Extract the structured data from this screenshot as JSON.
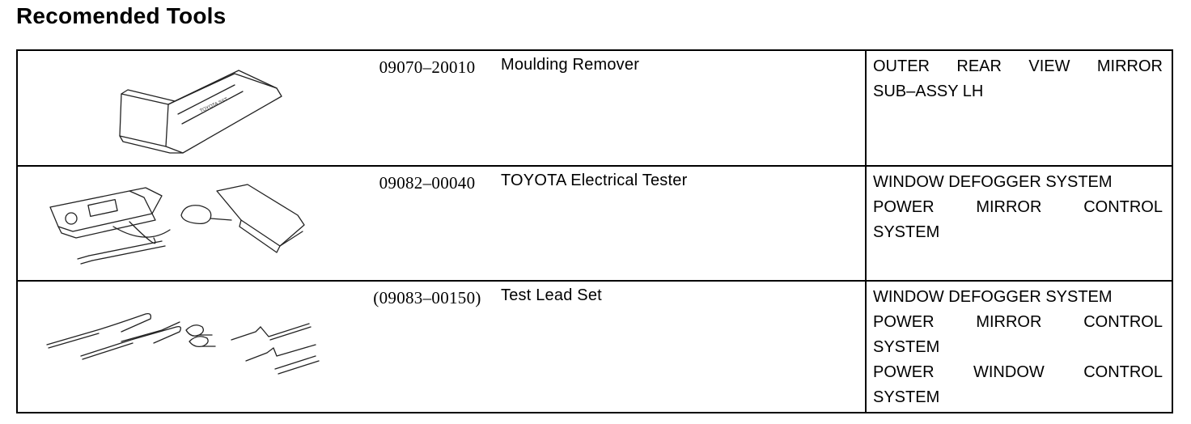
{
  "title": "Recomended Tools",
  "tools": [
    {
      "part_number": "09070–20010",
      "name": "Moulding Remover",
      "illustration_icon": "moulding-remover-illustration",
      "uses": [
        {
          "words": [
            "OUTER",
            "REAR",
            "VIEW",
            "MIRROR"
          ]
        },
        {
          "words": [
            "SUB–ASSY LH"
          ]
        }
      ]
    },
    {
      "part_number": "09082–00040",
      "name": "TOYOTA Electrical Tester",
      "illustration_icon": "electrical-tester-illustration",
      "uses": [
        {
          "words": [
            "WINDOW DEFOGGER SYSTEM"
          ]
        },
        {
          "words": [
            "POWER",
            "MIRROR",
            "CONTROL"
          ]
        },
        {
          "words": [
            "SYSTEM"
          ]
        }
      ]
    },
    {
      "part_number": "(09083–00150)",
      "name": "Test Lead Set",
      "illustration_icon": "test-lead-set-illustration",
      "uses": [
        {
          "words": [
            "WINDOW DEFOGGER SYSTEM"
          ]
        },
        {
          "words": [
            "POWER",
            "MIRROR",
            "CONTROL"
          ]
        },
        {
          "words": [
            "SYSTEM"
          ]
        },
        {
          "words": [
            "POWER",
            "WINDOW",
            "CONTROL"
          ]
        },
        {
          "words": [
            "SYSTEM"
          ]
        }
      ]
    }
  ]
}
